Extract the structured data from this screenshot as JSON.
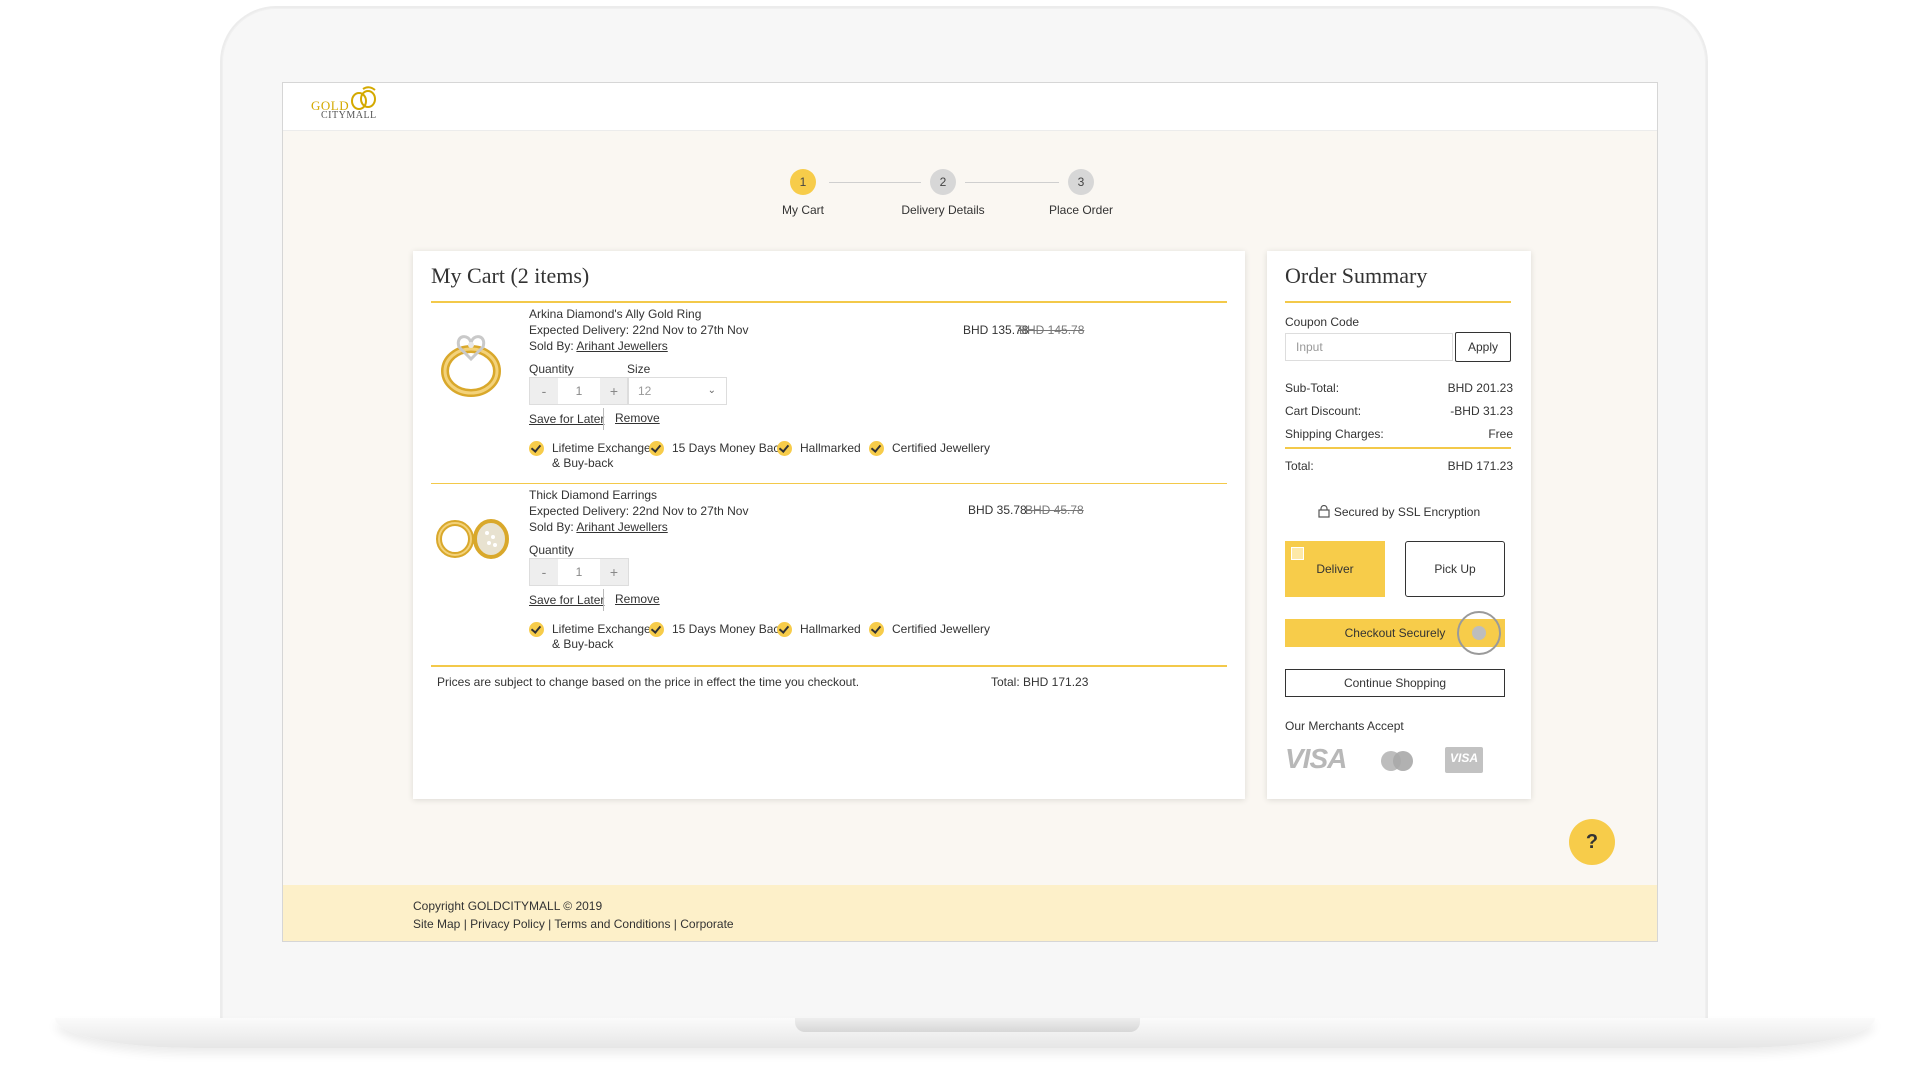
{
  "brand": {
    "logo_line1": "GOLD",
    "logo_line2": "CITYMALL"
  },
  "stepper": [
    {
      "number": "1",
      "label": "My Cart",
      "state": "active"
    },
    {
      "number": "2",
      "label": "Delivery Details",
      "state": "todo"
    },
    {
      "number": "3",
      "label": "Place Order",
      "state": "todo"
    }
  ],
  "cart": {
    "title": "My Cart (2 items)",
    "items": [
      {
        "name": "Arkina Diamond's Ally Gold Ring",
        "delivery_label": "Expected Delivery:",
        "delivery_value": "22nd Nov to 27th Nov",
        "sold_by_label": "Sold By:",
        "seller": "Arihant Jewellers",
        "price": "BHD 135.78",
        "old_price": "BHD 145.78",
        "quantity_label": "Quantity",
        "quantity": "1",
        "size_label": "Size",
        "size": "12",
        "image_icon": "gold-ring-icon"
      },
      {
        "name": "Thick Diamond Earrings",
        "delivery_label": "Expected Delivery:",
        "delivery_value": "22nd Nov to 27th Nov",
        "sold_by_label": "Sold By:",
        "seller": "Arihant Jewellers",
        "price": "BHD 35.78",
        "old_price": "BHD 45.78",
        "quantity_label": "Quantity",
        "quantity": "1",
        "image_icon": "gold-earrings-icon"
      }
    ],
    "stepper_minus": "-",
    "stepper_plus": "+",
    "save_for_later": "Save for Later",
    "remove": "Remove",
    "badges": [
      "Lifetime Exchange & Buy-back",
      "15 Days Money Back",
      "Hallmarked",
      "Certified Jewellery"
    ],
    "badge_line1": "Lifetime Exchange",
    "badge_line2": "& Buy-back",
    "note": "Prices are subject to change based on the price in effect the time you checkout.",
    "total": "Total: BHD 171.23"
  },
  "summary": {
    "title": "Order Summary",
    "coupon_label": "Coupon Code",
    "coupon_placeholder": "Input",
    "apply": "Apply",
    "subtotal_label": "Sub-Total:",
    "subtotal": "BHD 201.23",
    "discount_label": "Cart Discount:",
    "discount": "-BHD 31.23",
    "shipping_label": "Shipping Charges:",
    "shipping": "Free",
    "total_label": "Total:",
    "total": "BHD 171.23",
    "secure": "Secured by SSL Encryption",
    "deliver": "Deliver",
    "pickup": "Pick Up",
    "checkout": "Checkout Securely",
    "continue": "Continue Shopping",
    "merchants": "Our Merchants Accept",
    "visa": "VISA",
    "visa_card": "VISA"
  },
  "help": "?",
  "footer": {
    "copyright": "Copyright GOLDCITYMALL © 2019",
    "links": "Site Map | Privacy Policy | Terms and Conditions | Corporate"
  },
  "colors": {
    "accent": "#f7cc4a",
    "footer_bg": "#fdf0c9",
    "page_bg": "#faf7f2"
  }
}
